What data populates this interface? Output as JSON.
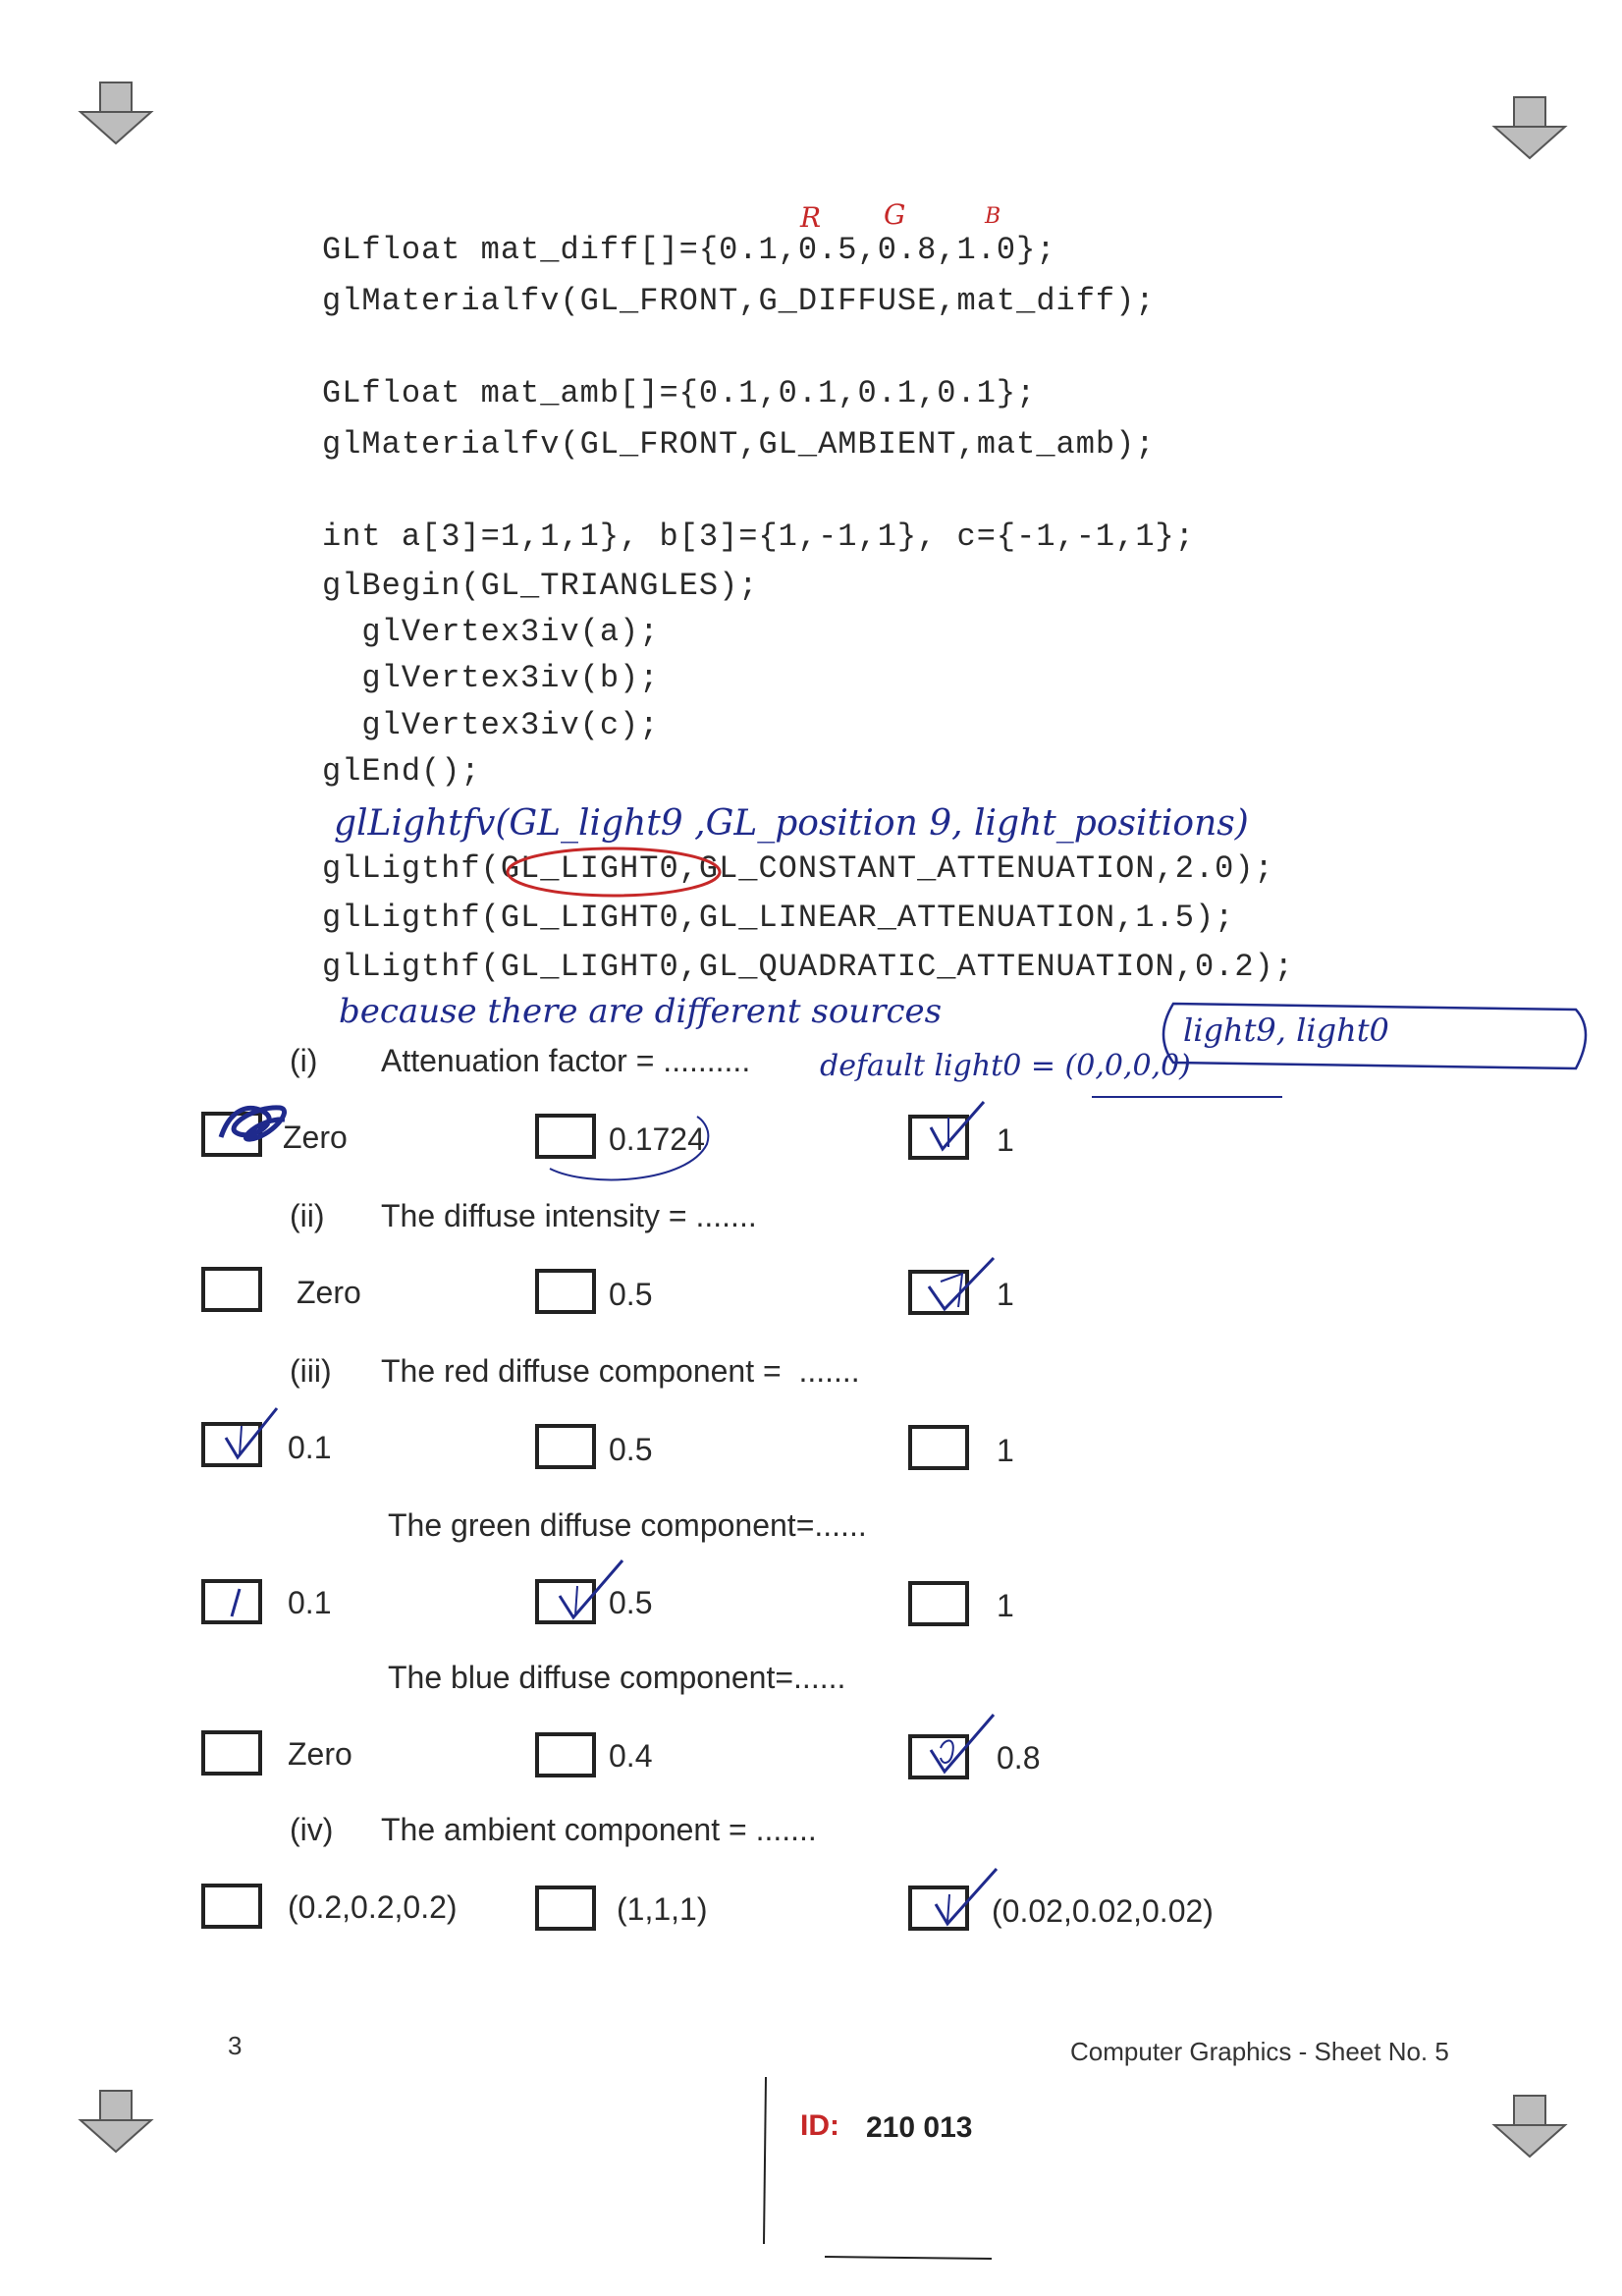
{
  "code": {
    "rgb_marks": [
      "R",
      "G",
      "B"
    ],
    "lines": [
      "GLfloat mat_diff[]={0.1,0.5,0.8,1.0};",
      "glMaterialfv(GL_FRONT,G_DIFFUSE,mat_diff);",
      "GLfloat mat_amb[]={0.1,0.1,0.1,0.1};",
      "glMaterialfv(GL_FRONT,GL_AMBIENT,mat_amb);",
      "int a[3]=1,1,1}, b[3]={1,-1,1}, c={-1,-1,1};",
      "glBegin(GL_TRIANGLES);",
      "  glVertex3iv(a);",
      "  glVertex3iv(b);",
      "  glVertex3iv(c);",
      "glEnd();",
      "glLigthf(GL_LIGHT0,GL_CONSTANT_ATTENUATION,2.0);",
      "glLigthf(GL_LIGHT0,GL_LINEAR_ATTENUATION,1.5);",
      "glLigthf(GL_LIGHT0,GL_QUADRATIC_ATTENUATION,0.2);"
    ]
  },
  "handwriting": {
    "note1": "glLightfv(GL_light9 ,GL_position 9, light_positions)",
    "note2": "because there are different sources",
    "note3": "light9, light0",
    "note4": "default light0 = (0,0,0,0)"
  },
  "questions": [
    {
      "num": "(i)",
      "text": "Attenuation factor = ..........",
      "options": [
        "Zero",
        "0.1724",
        "1"
      ]
    },
    {
      "num": "(ii)",
      "text": "The diffuse intensity = .......",
      "options": [
        "Zero",
        "0.5",
        "1"
      ]
    },
    {
      "num": "(iii)",
      "text": "The red diffuse component =  .......",
      "options": [
        "0.1",
        "0.5",
        "1"
      ]
    },
    {
      "num": "",
      "text": "The green diffuse component=......",
      "options": [
        "0.1",
        "0.5",
        "1"
      ]
    },
    {
      "num": "",
      "text": "The blue diffuse component=......",
      "options": [
        "Zero",
        "0.4",
        "0.8"
      ]
    },
    {
      "num": "(iv)",
      "text": "The ambient component = .......",
      "options": [
        "(0.2,0.2,0.2)",
        "(1,1,1)",
        "(0.02,0.02,0.02)"
      ]
    }
  ],
  "footer": {
    "page_number": "3",
    "course": "Computer Graphics - Sheet No. 5",
    "id_label": "ID:",
    "id_value": "210 013"
  }
}
